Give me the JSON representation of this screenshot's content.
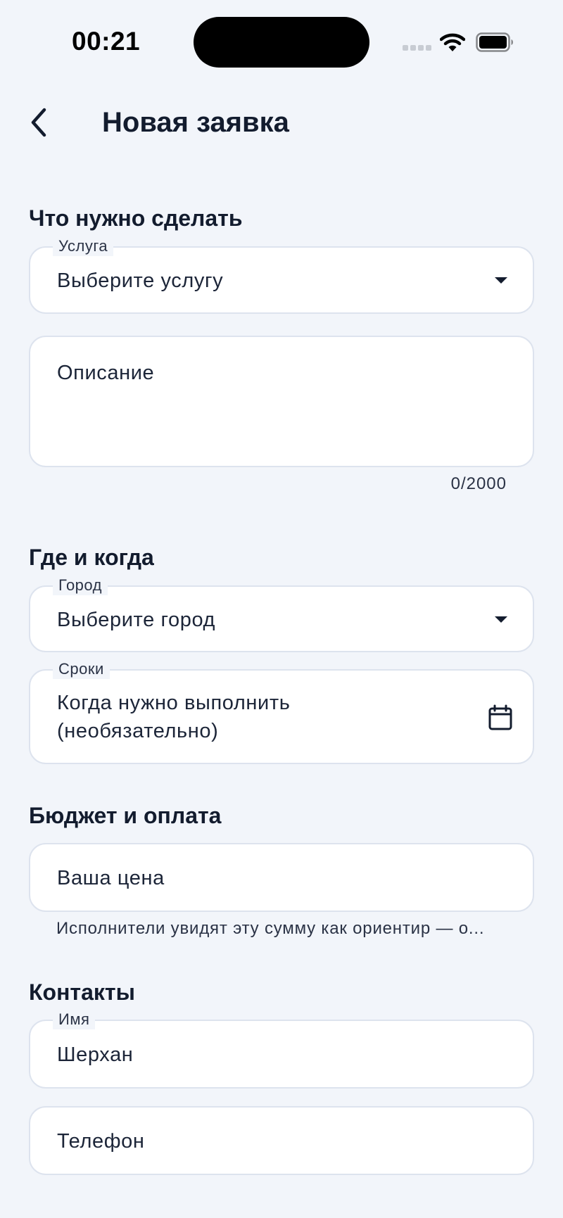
{
  "status_bar": {
    "time": "00:21"
  },
  "header": {
    "title": "Новая заявка"
  },
  "sections": {
    "what": {
      "title": "Что нужно сделать",
      "service": {
        "label": "Услуга",
        "value": "Выберите услугу"
      },
      "description": {
        "placeholder": "Описание",
        "counter": "0/2000"
      }
    },
    "where": {
      "title": "Где и когда",
      "city": {
        "label": "Город",
        "value": "Выберите город"
      },
      "deadline": {
        "label": "Сроки",
        "line1": "Когда нужно выполнить",
        "line2": "(необязательно)"
      }
    },
    "budget": {
      "title": "Бюджет и оплата",
      "price": {
        "placeholder": "Ваша цена"
      },
      "helper": "Исполнители увидят эту сумму как ориентир — о..."
    },
    "contacts": {
      "title": "Контакты",
      "name": {
        "label": "Имя",
        "value": "Шерхан"
      },
      "phone": {
        "placeholder": "Телефон"
      }
    }
  },
  "colors": {
    "background": "#f2f5fa",
    "field_background": "#ffffff",
    "field_border": "#dde3ee",
    "text": "#131c2e"
  },
  "icons": [
    "signal-icon",
    "wifi-icon",
    "battery-icon",
    "back-arrow-icon",
    "dropdown-arrow-icon",
    "calendar-icon"
  ]
}
